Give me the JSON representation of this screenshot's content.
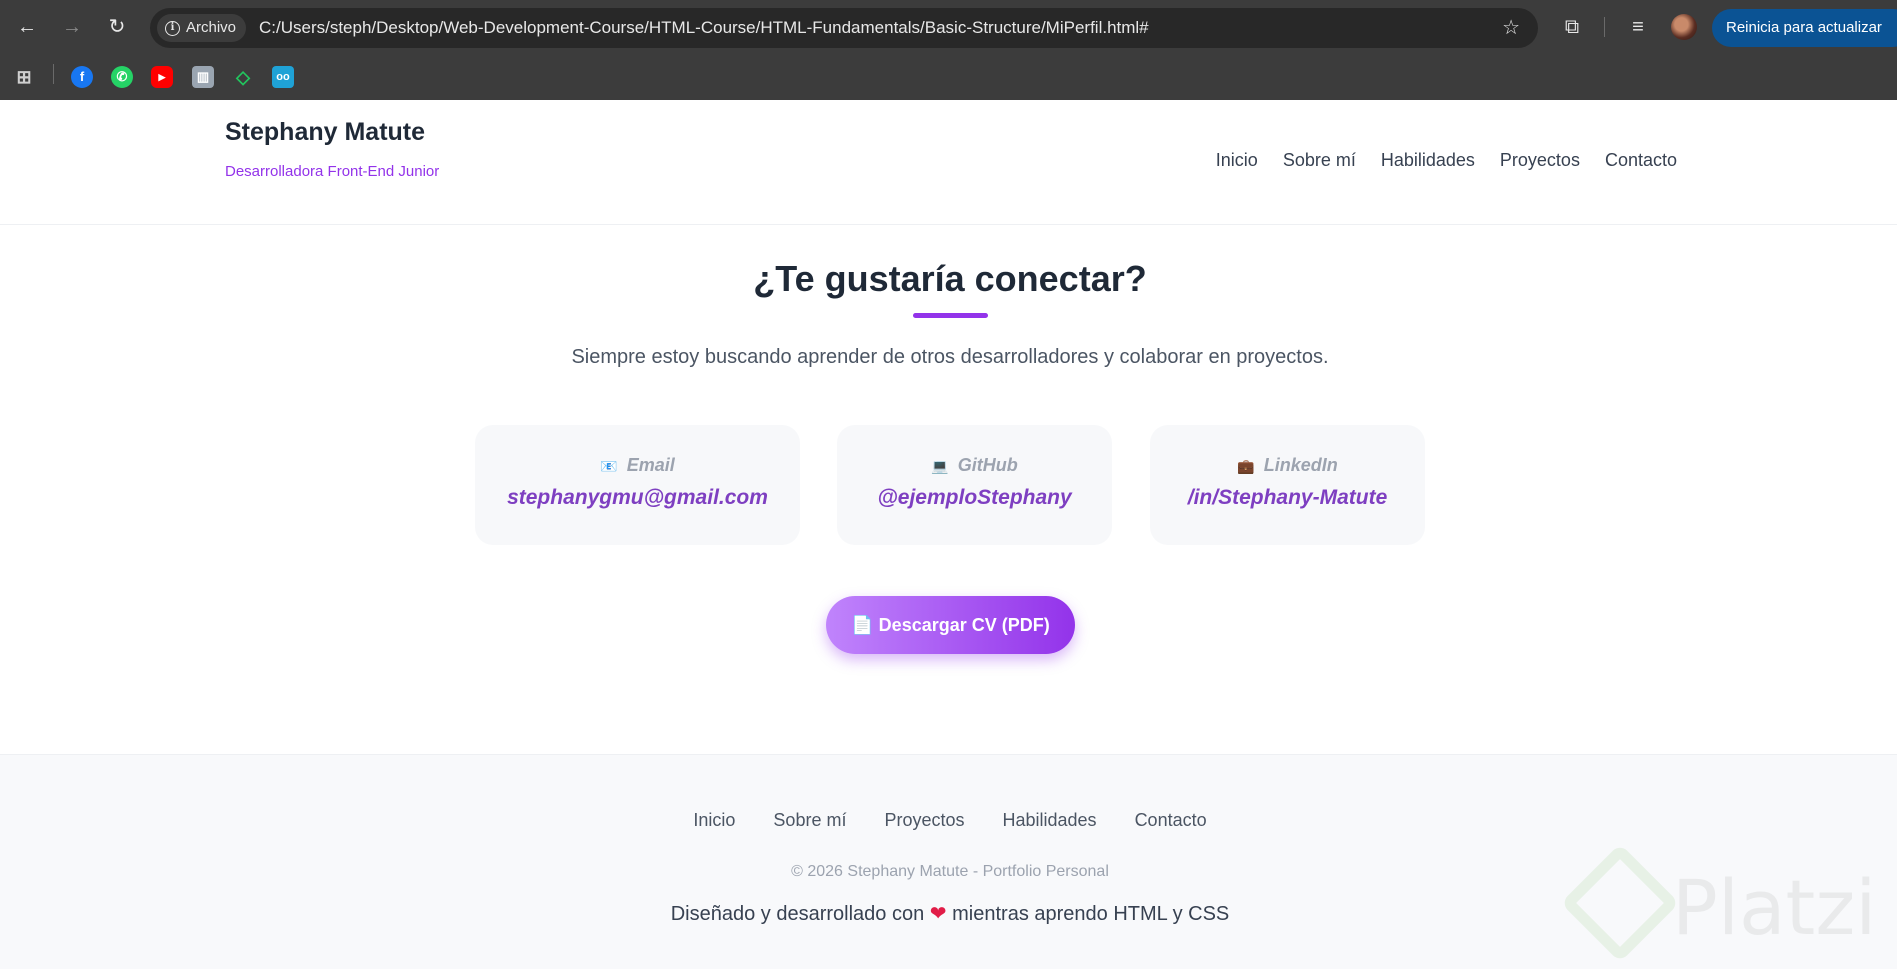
{
  "browser": {
    "nav": {
      "back": "←",
      "forward": "→",
      "reload": "↻"
    },
    "address": {
      "chip_label": "Archivo",
      "url": "C:/Users/steph/Desktop/Web-Development-Course/HTML-Course/HTML-Fundamentals/Basic-Structure/MiPerfil.html#"
    },
    "update_button": "Reinicia para actualizar",
    "icons": {
      "star": "☆",
      "extensions": "⧉",
      "media": "≡",
      "menu": "⋮"
    },
    "bookmarks": {
      "apps": "⊞",
      "facebook": "f",
      "whatsapp": "✆",
      "youtube": "▶",
      "library": "▥",
      "linkedin_like": "◇",
      "robot": "oo"
    }
  },
  "header": {
    "name": "Stephany Matute",
    "role": "Desarrolladora Front-End Junior",
    "nav": [
      "Inicio",
      "Sobre mí",
      "Habilidades",
      "Proyectos",
      "Contacto"
    ]
  },
  "contact": {
    "title": "¿Te gustaría conectar?",
    "subtitle": "Siempre estoy buscando aprender de otros desarrolladores y colaborar en proyectos.",
    "cards": [
      {
        "emoji": "📧",
        "label": "Email",
        "value": "stephanygmu@gmail.com"
      },
      {
        "emoji": "💻",
        "label": "GitHub",
        "value": "@ejemploStephany"
      },
      {
        "emoji": "💼",
        "label": "LinkedIn",
        "value": "/in/Stephany-Matute"
      }
    ],
    "cv_button": "📄 Descargar CV (PDF)"
  },
  "footer": {
    "nav": [
      "Inicio",
      "Sobre mí",
      "Proyectos",
      "Habilidades",
      "Contacto"
    ],
    "copyright": "© 2026 Stephany Matute - Portfolio Personal",
    "made_with_before": "Diseñado y desarrollado con",
    "heart": "❤",
    "made_with_after": "mientras aprendo HTML y CSS"
  },
  "watermark": {
    "text": "Platzi"
  },
  "colors": {
    "accent": "#9333ea",
    "chrome": "#3c3c3c",
    "update_button": "#0b5394"
  }
}
